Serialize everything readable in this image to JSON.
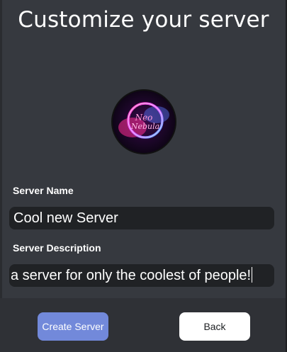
{
  "dialog": {
    "title": "Customize your server"
  },
  "avatar": {
    "logo_text_line1": "Neo",
    "logo_text_line2": "Nebula"
  },
  "form": {
    "server_name_label": "Server Name",
    "server_name_value": "Cool new Server",
    "server_description_label": "Server Description",
    "server_description_value": "a server for only the coolest of people!"
  },
  "buttons": {
    "create_label": "Create Server",
    "back_label": "Back"
  },
  "colors": {
    "panel": "#36393f",
    "input_bg": "#202225",
    "footer": "#2f3136",
    "accent": "#7289da"
  }
}
